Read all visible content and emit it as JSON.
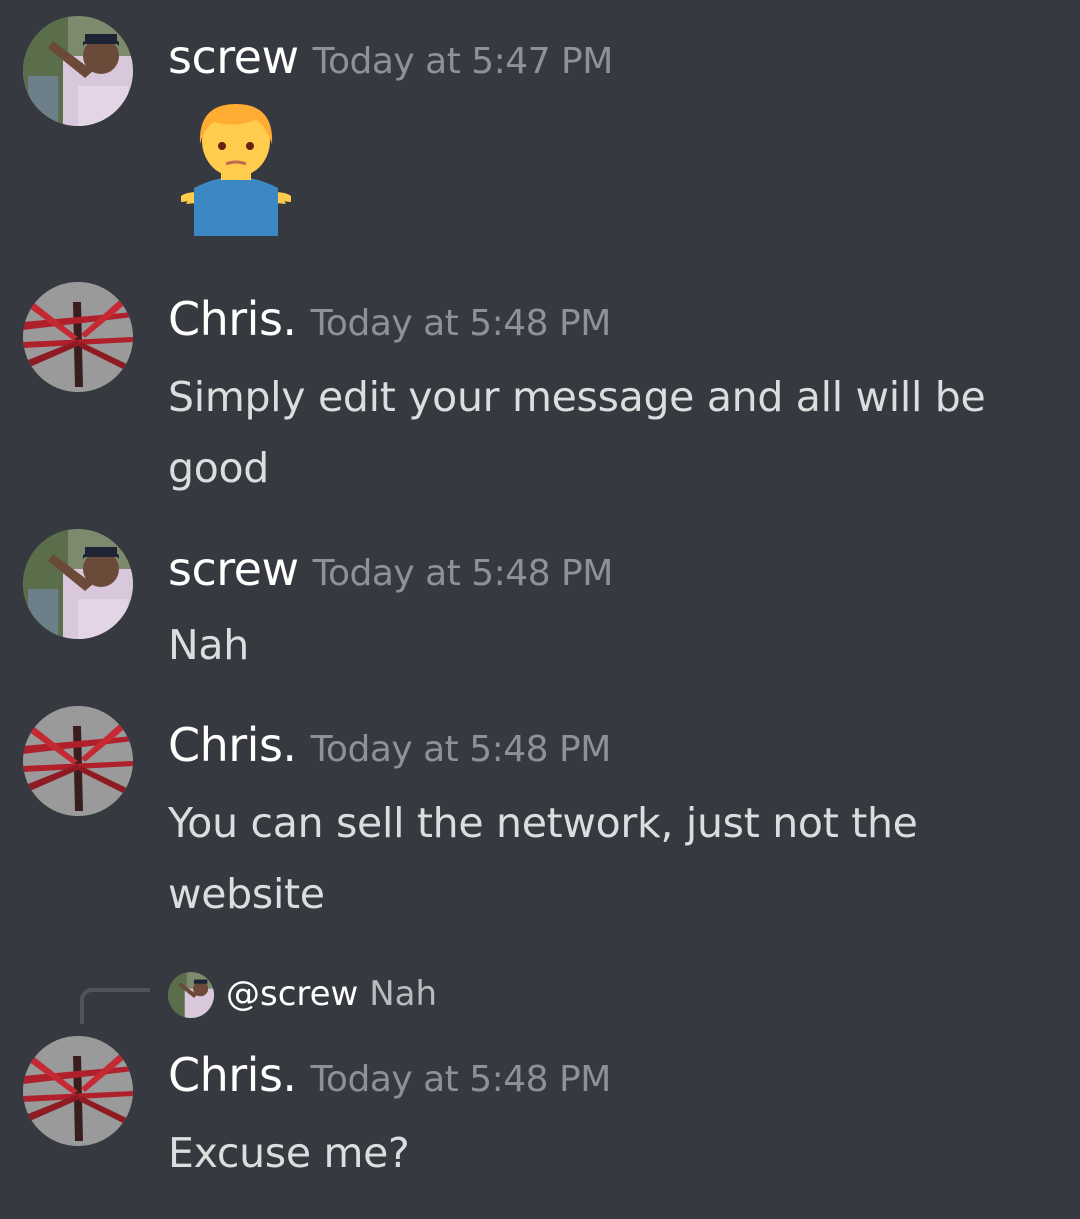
{
  "messages": [
    {
      "author": "screw",
      "timestamp": "Today at 5:47 PM",
      "avatar": "screw-avatar",
      "content_emoji": "shrug-man-emoji"
    },
    {
      "author": "Chris.",
      "timestamp": "Today at 5:48 PM",
      "avatar": "chris-avatar",
      "lines": [
        "Simply edit your message and all will be",
        "good"
      ]
    },
    {
      "author": "screw",
      "timestamp": "Today at 5:48 PM",
      "avatar": "screw-avatar",
      "lines": [
        "Nah"
      ]
    },
    {
      "author": "Chris.",
      "timestamp": "Today at 5:48 PM",
      "avatar": "chris-avatar",
      "lines": [
        "You can sell the network, just not the",
        "website"
      ]
    },
    {
      "author": "Chris.",
      "timestamp": "Today at 5:48 PM",
      "avatar": "chris-avatar",
      "reply": {
        "mention": "@screw",
        "text": "Nah"
      },
      "lines": [
        "Excuse me?"
      ]
    }
  ],
  "colors": {
    "background": "#36393f",
    "username": "#ffffff",
    "timestamp": "#8e9297",
    "text": "#dcddde",
    "reply_spine": "#4f545c"
  }
}
